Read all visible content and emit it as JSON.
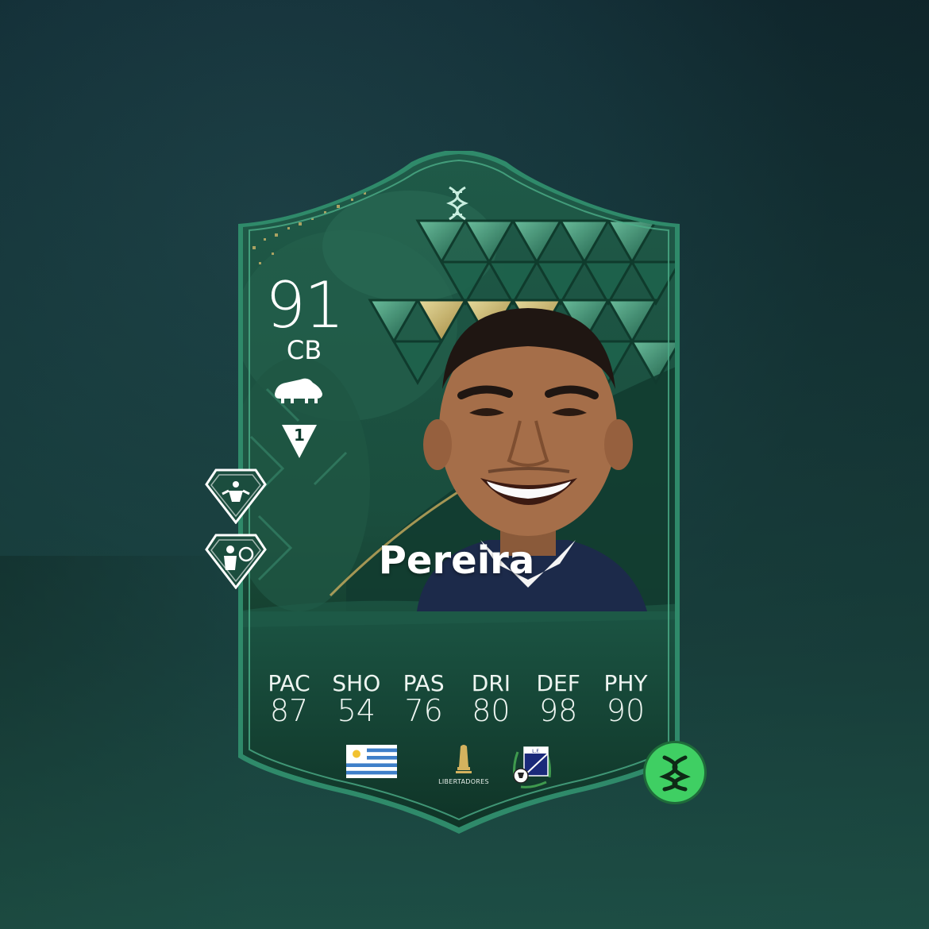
{
  "player": {
    "rating": "91",
    "position": "CB",
    "name": "Pereira",
    "skill_badge": "1"
  },
  "stats": [
    {
      "label": "PAC",
      "value": "87"
    },
    {
      "label": "SHO",
      "value": "54"
    },
    {
      "label": "PAS",
      "value": "76"
    },
    {
      "label": "DRI",
      "value": "80"
    },
    {
      "label": "DEF",
      "value": "98"
    },
    {
      "label": "PHY",
      "value": "90"
    }
  ],
  "card": {
    "league_logo_text": "LIBERTADORES",
    "nation_flag": "uruguay-flag",
    "club_badge": "club-crest-icon",
    "accent_color": "#2f8a6a",
    "evolution_button_color": "#3fcf63"
  },
  "icons": {
    "preferred_foot": "boot-icon",
    "dna": "dna-icon",
    "playstyle_1": "playstyle-intercept-icon",
    "playstyle_2": "playstyle-block-icon",
    "evolution": "evolution-dna-icon"
  }
}
